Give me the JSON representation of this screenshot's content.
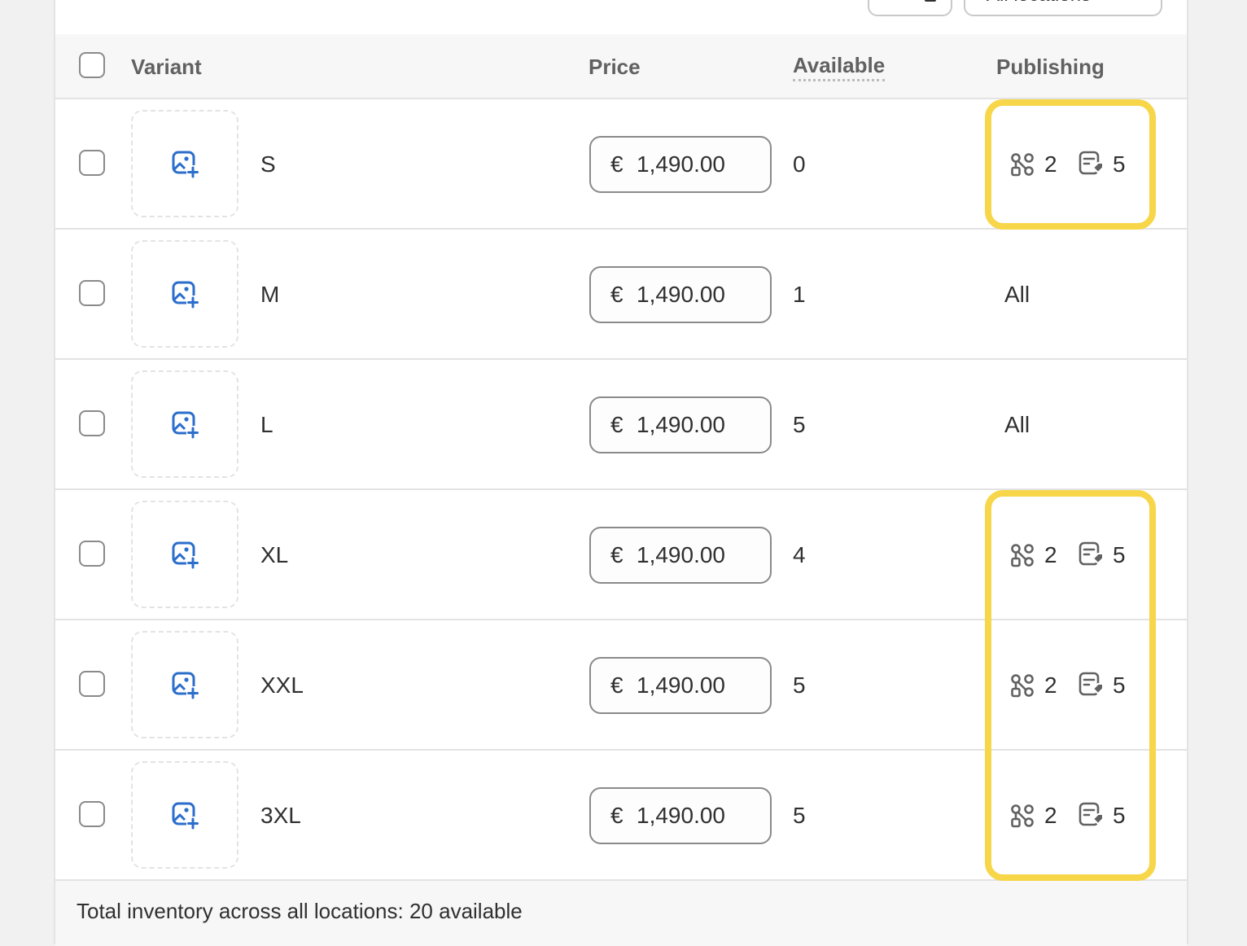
{
  "toolbar": {
    "search_sort_button": "search and sort",
    "locations_label": "All locations",
    "locations_chevron": "⌄"
  },
  "table": {
    "headers": {
      "variant": "Variant",
      "price": "Price",
      "available": "Available",
      "publishing": "Publishing"
    },
    "rows": [
      {
        "name": "S",
        "currency": "€",
        "price": "1,490.00",
        "available": "0",
        "publishing_type": "counts",
        "channels": "2",
        "catalogs": "5",
        "highlighted": true
      },
      {
        "name": "M",
        "currency": "€",
        "price": "1,490.00",
        "available": "1",
        "publishing_type": "all",
        "publishing_text": "All",
        "highlighted": false
      },
      {
        "name": "L",
        "currency": "€",
        "price": "1,490.00",
        "available": "5",
        "publishing_type": "all",
        "publishing_text": "All",
        "highlighted": false
      },
      {
        "name": "XL",
        "currency": "€",
        "price": "1,490.00",
        "available": "4",
        "publishing_type": "counts",
        "channels": "2",
        "catalogs": "5",
        "highlighted": true
      },
      {
        "name": "XXL",
        "currency": "€",
        "price": "1,490.00",
        "available": "5",
        "publishing_type": "counts",
        "channels": "2",
        "catalogs": "5",
        "highlighted": true
      },
      {
        "name": "3XL",
        "currency": "€",
        "price": "1,490.00",
        "available": "5",
        "publishing_type": "counts",
        "channels": "2",
        "catalogs": "5",
        "highlighted": true
      }
    ]
  },
  "footer": {
    "total_text": "Total inventory across all locations: 20 available"
  },
  "icons": {
    "thumbnail": "image-add-icon",
    "channels": "channels-icon",
    "catalogs": "catalog-tag-icon"
  },
  "colors": {
    "highlight": "#f7d64a",
    "icon_blue": "#2c6ecb",
    "text": "#303030",
    "muted": "#616161"
  }
}
